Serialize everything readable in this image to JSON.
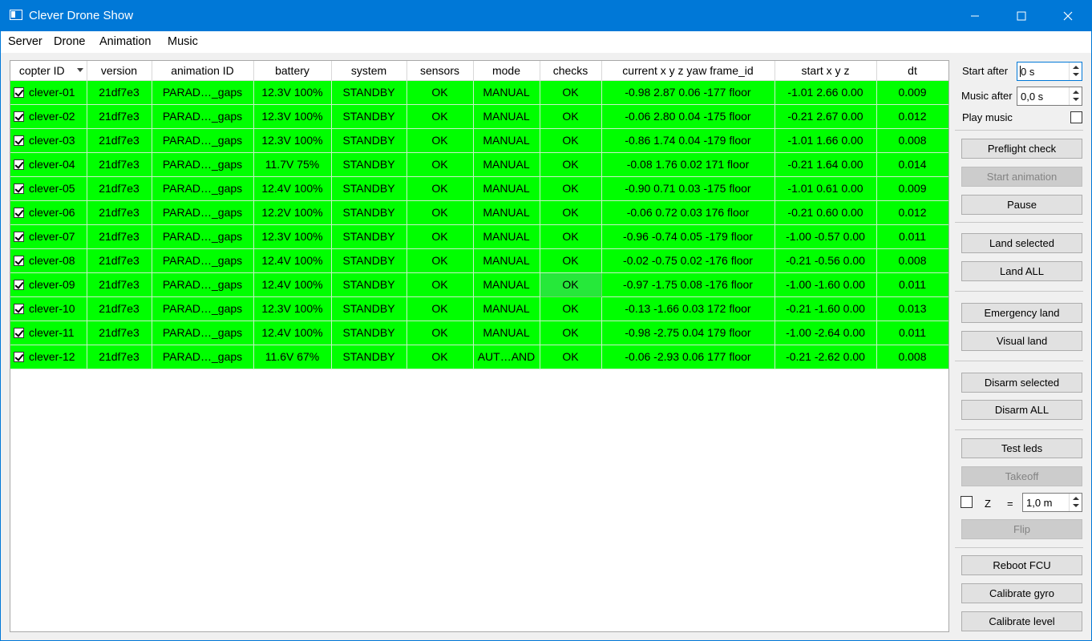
{
  "window": {
    "title": "Clever Drone Show"
  },
  "menu": [
    "Server",
    "Drone",
    "Animation",
    "Music"
  ],
  "table": {
    "columns": [
      "copter ID",
      "version",
      "animation ID",
      "battery",
      "system",
      "sensors",
      "mode",
      "checks",
      "current x y z yaw frame_id",
      "start x y z",
      "dt"
    ],
    "rows": [
      {
        "id": "clever-01",
        "checked": true,
        "version": "21df7e3",
        "animation": "PARAD…_gaps",
        "battery": "12.3V 100%",
        "system": "STANDBY",
        "sensors": "OK",
        "mode": "MANUAL",
        "checks": "OK",
        "current": "-0.98 2.87 0.06 -177 floor",
        "start": "-1.01 2.66 0.00",
        "dt": "0.009"
      },
      {
        "id": "clever-02",
        "checked": true,
        "version": "21df7e3",
        "animation": "PARAD…_gaps",
        "battery": "12.3V 100%",
        "system": "STANDBY",
        "sensors": "OK",
        "mode": "MANUAL",
        "checks": "OK",
        "current": "-0.06 2.80 0.04 -175 floor",
        "start": "-0.21 2.67 0.00",
        "dt": "0.012"
      },
      {
        "id": "clever-03",
        "checked": true,
        "version": "21df7e3",
        "animation": "PARAD…_gaps",
        "battery": "12.3V 100%",
        "system": "STANDBY",
        "sensors": "OK",
        "mode": "MANUAL",
        "checks": "OK",
        "current": "-0.86 1.74 0.04 -179 floor",
        "start": "-1.01 1.66 0.00",
        "dt": "0.008"
      },
      {
        "id": "clever-04",
        "checked": true,
        "version": "21df7e3",
        "animation": "PARAD…_gaps",
        "battery": "11.7V 75%",
        "system": "STANDBY",
        "sensors": "OK",
        "mode": "MANUAL",
        "checks": "OK",
        "current": "-0.08 1.76 0.02 171 floor",
        "start": "-0.21 1.64 0.00",
        "dt": "0.014"
      },
      {
        "id": "clever-05",
        "checked": true,
        "version": "21df7e3",
        "animation": "PARAD…_gaps",
        "battery": "12.4V 100%",
        "system": "STANDBY",
        "sensors": "OK",
        "mode": "MANUAL",
        "checks": "OK",
        "current": "-0.90 0.71 0.03 -175 floor",
        "start": "-1.01 0.61 0.00",
        "dt": "0.009"
      },
      {
        "id": "clever-06",
        "checked": true,
        "version": "21df7e3",
        "animation": "PARAD…_gaps",
        "battery": "12.2V 100%",
        "system": "STANDBY",
        "sensors": "OK",
        "mode": "MANUAL",
        "checks": "OK",
        "current": "-0.06 0.72 0.03 176 floor",
        "start": "-0.21 0.60 0.00",
        "dt": "0.012"
      },
      {
        "id": "clever-07",
        "checked": true,
        "version": "21df7e3",
        "animation": "PARAD…_gaps",
        "battery": "12.3V 100%",
        "system": "STANDBY",
        "sensors": "OK",
        "mode": "MANUAL",
        "checks": "OK",
        "current": "-0.96 -0.74 0.05 -179 floor",
        "start": "-1.00 -0.57 0.00",
        "dt": "0.011"
      },
      {
        "id": "clever-08",
        "checked": true,
        "version": "21df7e3",
        "animation": "PARAD…_gaps",
        "battery": "12.4V 100%",
        "system": "STANDBY",
        "sensors": "OK",
        "mode": "MANUAL",
        "checks": "OK",
        "current": "-0.02 -0.75 0.02 -176 floor",
        "start": "-0.21 -0.56 0.00",
        "dt": "0.008"
      },
      {
        "id": "clever-09",
        "checked": true,
        "version": "21df7e3",
        "animation": "PARAD…_gaps",
        "battery": "12.4V 100%",
        "system": "STANDBY",
        "sensors": "OK",
        "mode": "MANUAL",
        "checks": "OK",
        "current": "-0.97 -1.75 0.08 -176 floor",
        "start": "-1.00 -1.60 0.00",
        "dt": "0.011",
        "focused": "checks"
      },
      {
        "id": "clever-10",
        "checked": true,
        "version": "21df7e3",
        "animation": "PARAD…_gaps",
        "battery": "12.3V 100%",
        "system": "STANDBY",
        "sensors": "OK",
        "mode": "MANUAL",
        "checks": "OK",
        "current": "-0.13 -1.66 0.03 172 floor",
        "start": "-0.21 -1.60 0.00",
        "dt": "0.013"
      },
      {
        "id": "clever-11",
        "checked": true,
        "version": "21df7e3",
        "animation": "PARAD…_gaps",
        "battery": "12.4V 100%",
        "system": "STANDBY",
        "sensors": "OK",
        "mode": "MANUAL",
        "checks": "OK",
        "current": "-0.98 -2.75 0.04 179 floor",
        "start": "-1.00 -2.64 0.00",
        "dt": "0.011"
      },
      {
        "id": "clever-12",
        "checked": true,
        "version": "21df7e3",
        "animation": "PARAD…_gaps",
        "battery": "11.6V 67%",
        "system": "STANDBY",
        "sensors": "OK",
        "mode": "AUT…AND",
        "checks": "OK",
        "current": "-0.06 -2.93 0.06 177 floor",
        "start": "-0.21 -2.62 0.00",
        "dt": "0.008"
      }
    ]
  },
  "controls": {
    "start_after_label": "Start after",
    "start_after_value": "0 s",
    "music_after_label": "Music after",
    "music_after_value": "0,0 s",
    "play_music_label": "Play music",
    "z_label": "Z",
    "z_equals": "=",
    "z_value": "1,0 m",
    "buttons": {
      "preflight": "Preflight check",
      "start_animation": "Start animation",
      "pause": "Pause",
      "land_selected": "Land selected",
      "land_all": "Land ALL",
      "emergency_land": "Emergency land",
      "visual_land": "Visual land",
      "disarm_selected": "Disarm selected",
      "disarm_all": "Disarm ALL",
      "test_leds": "Test leds",
      "takeoff": "Takeoff",
      "flip": "Flip",
      "reboot_fcu": "Reboot FCU",
      "calibrate_gyro": "Calibrate gyro",
      "calibrate_level": "Calibrate level"
    }
  },
  "colors": {
    "row_ok": "#00ff00",
    "titlebar": "#0078d7"
  }
}
